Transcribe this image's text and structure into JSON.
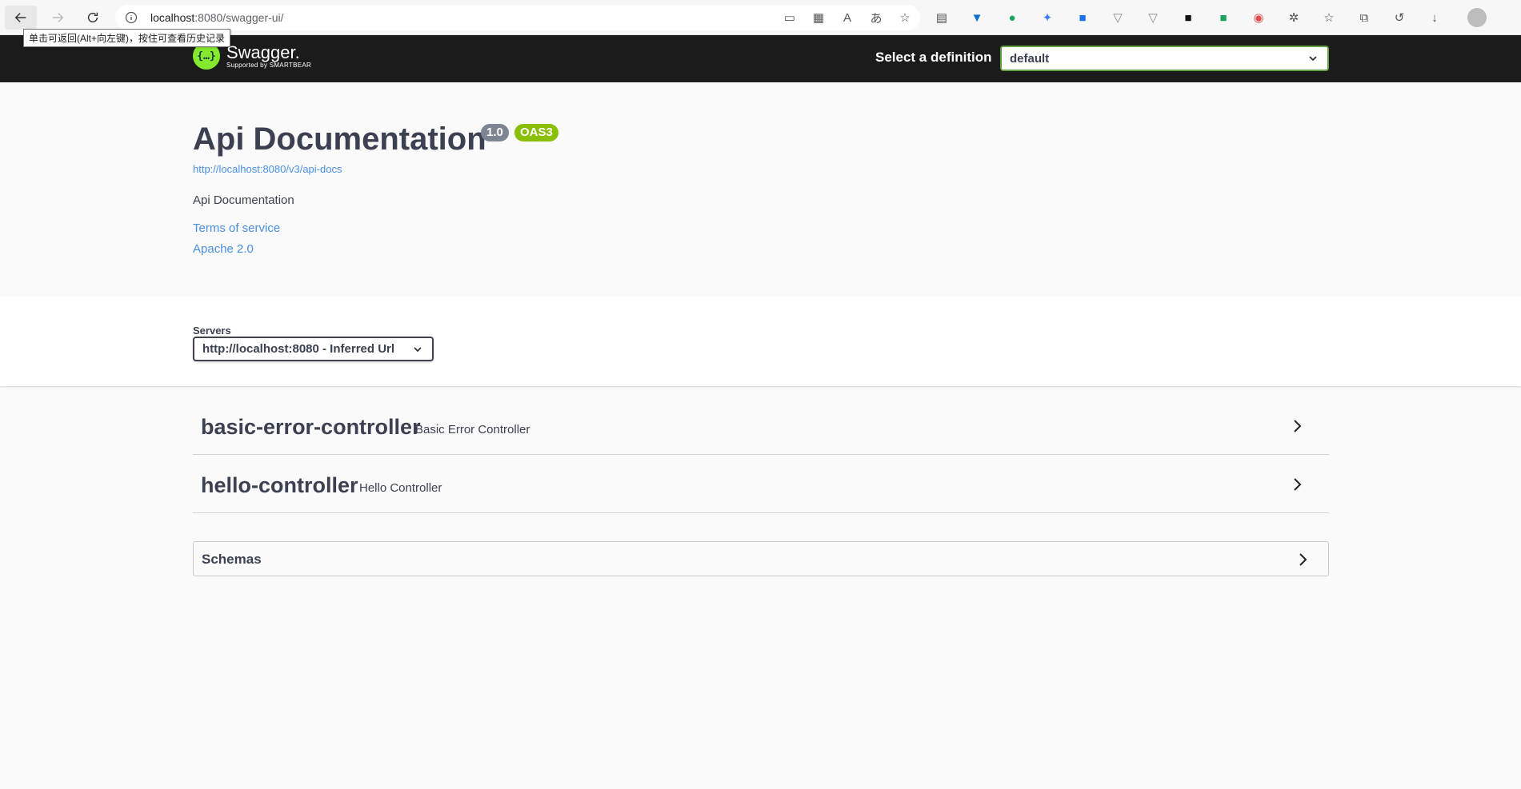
{
  "browser": {
    "url_host": "localhost",
    "url_rest": ":8080/swagger-ui/",
    "back_tooltip": "单击可返回(Alt+向左键)，按住可查看历史记录"
  },
  "topbar": {
    "logo_name": "Swagger.",
    "logo_sub": "Supported by SMARTBEAR",
    "definition_label": "Select a definition",
    "definition_value": "default"
  },
  "info": {
    "title": "Api Documentation",
    "version": "1.0",
    "oas": "OAS3",
    "spec_url": "http://localhost:8080/v3/api-docs",
    "description": "Api Documentation",
    "terms": "Terms of service",
    "license": "Apache 2.0"
  },
  "servers": {
    "label": "Servers",
    "selected": "http://localhost:8080 - Inferred Url"
  },
  "tags": [
    {
      "name": "basic-error-controller",
      "description": "Basic Error Controller"
    },
    {
      "name": "hello-controller",
      "description": "Hello Controller"
    }
  ],
  "schemas": {
    "label": "Schemas"
  },
  "colors": {
    "topbar_bg": "#1b1b1b",
    "accent_green": "#89bf04",
    "link": "#4990e2"
  }
}
